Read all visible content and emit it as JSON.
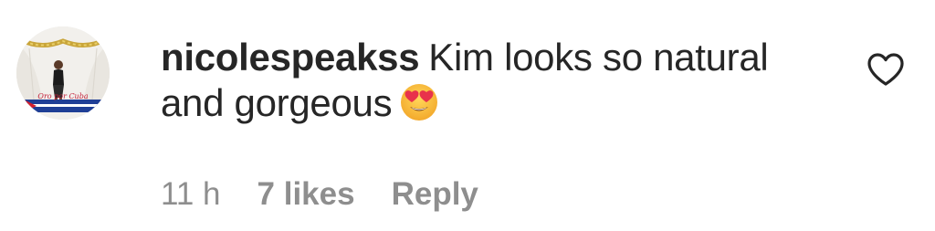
{
  "comment": {
    "username": "nicolespeakss",
    "text": "Kim looks so natural and gorgeous",
    "emoji": "heart-eyes-emoji",
    "avatar": {
      "banner_text": "Oro por Cuba"
    }
  },
  "meta": {
    "time": "11 h",
    "likes": "7 likes",
    "reply_label": "Reply"
  },
  "icons": {
    "like": "heart-outline-icon"
  },
  "colors": {
    "text": "#262626",
    "secondary": "#8e8e8e",
    "background": "#ffffff"
  }
}
